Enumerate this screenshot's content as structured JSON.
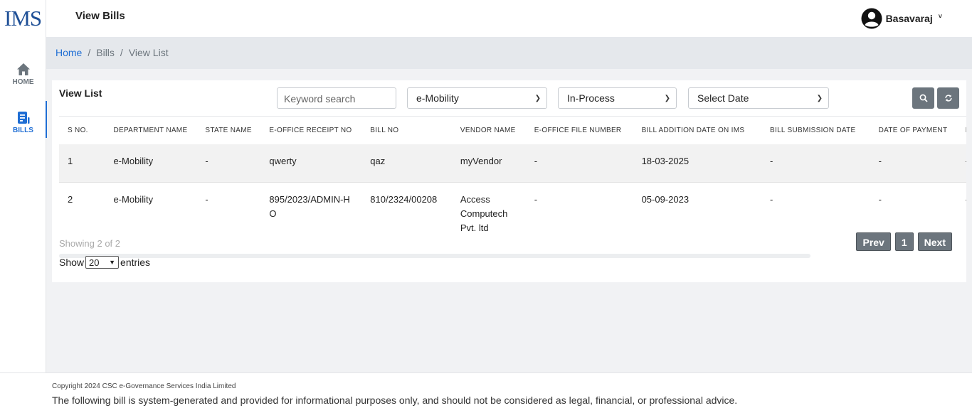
{
  "app": {
    "logo": "IMS"
  },
  "sidebar": {
    "items": [
      {
        "label": "HOME",
        "icon": "home-icon"
      },
      {
        "label": "BILLS",
        "icon": "bills-icon",
        "active": true
      }
    ]
  },
  "header": {
    "title": "View Bills",
    "user": "Basavaraj"
  },
  "breadcrumb": {
    "home": "Home",
    "bills": "Bills",
    "current": "View List",
    "sep": "/"
  },
  "card": {
    "title": "View List",
    "search_placeholder": "Keyword search",
    "filter_category": "e-Mobility",
    "filter_status": "In-Process",
    "filter_date": "Select Date"
  },
  "table": {
    "columns": [
      "S NO.",
      "DEPARTMENT NAME",
      "STATE NAME",
      "E-OFFICE RECEIPT NO",
      "BILL NO",
      "VENDOR NAME",
      "E-OFFICE FILE NUMBER",
      "BILL ADDITION DATE ON IMS",
      "BILL SUBMISSION DATE",
      "DATE OF PAYMENT",
      "I"
    ],
    "rows": [
      [
        "1",
        "e-Mobility",
        "-",
        "qwerty",
        "qaz",
        "myVendor",
        "-",
        "18-03-2025",
        "-",
        "-",
        "-"
      ],
      [
        "2",
        "e-Mobility",
        "-",
        "895/2023/ADMIN-HO",
        "810/2324/00208",
        "Access Computech Pvt. ltd",
        "-",
        "05-09-2023",
        "-",
        "-",
        "-"
      ]
    ]
  },
  "pagination": {
    "showing": "Showing 2 of 2",
    "show_label": "Show",
    "entries_value": "20",
    "entries_label": "entries",
    "prev": "Prev",
    "page": "1",
    "next": "Next"
  },
  "footer": {
    "copyright": "Copyright 2024 CSC e-Governance Services India Limited",
    "disclaimer": "The following bill is system-generated and provided for informational purposes only, and should not be considered as legal, financial, or professional advice."
  },
  "colors": {
    "primary": "#1f6ed4",
    "button_gray": "#6c757d",
    "logo": "#1e4f96"
  }
}
